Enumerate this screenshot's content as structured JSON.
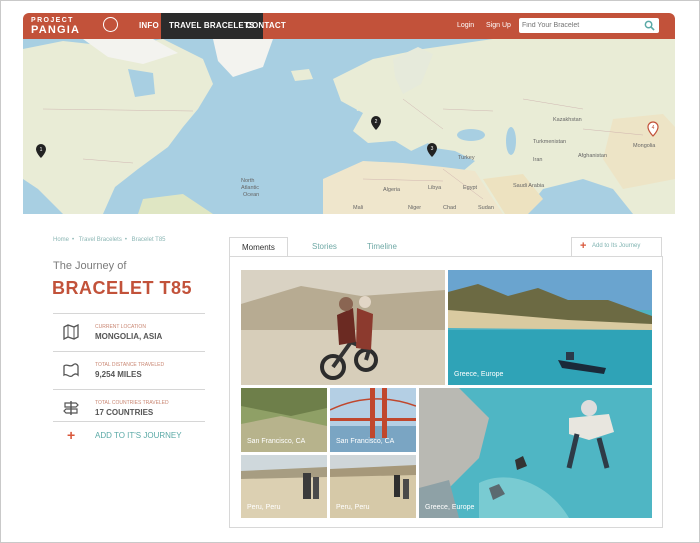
{
  "header": {
    "logo_line1": "PROJECT",
    "logo_line2": "PANGIA",
    "nav": {
      "info": "INFO",
      "bracelets": "TRAVEL BRACELETS",
      "contact": "CONTACT"
    },
    "login": "Login",
    "signup": "Sign Up",
    "search_placeholder": "Find Your Bracelet",
    "search_icon": "search-icon"
  },
  "map": {
    "markers": [
      "1",
      "2",
      "3",
      "4"
    ],
    "labels": [
      "North Atlantic Ocean",
      "Algeria",
      "Libya",
      "Egypt",
      "Saudi Arabia",
      "Kazakhstan",
      "Mongolia",
      "Turkey",
      "Iran",
      "Afghanistan",
      "Turkmenistan",
      "Mali",
      "Niger",
      "Chad",
      "Sudan"
    ]
  },
  "breadcrumb": [
    "Home",
    "Travel Bracelets",
    "Bracelet T85"
  ],
  "journey": {
    "title": "The Journey of",
    "name": "BRACELET T85",
    "stats": [
      {
        "label": "Current Location",
        "value": "MONGOLIA, ASIA",
        "icon": "map-icon"
      },
      {
        "label": "Total Distance Traveled",
        "value": "9,254 MILES",
        "icon": "folded-map-icon"
      },
      {
        "label": "Total Countries Traveled",
        "value": "17 COUNTRIES",
        "icon": "signpost-icon"
      }
    ],
    "add_label": "ADD TO IT'S JOURNEY"
  },
  "tabs": [
    "Moments",
    "Stories",
    "Timeline"
  ],
  "add_right": "Add to Its Journey",
  "photos": [
    {
      "caption": ""
    },
    {
      "caption": "Greece, Europe"
    },
    {
      "caption": "San Francisco, CA"
    },
    {
      "caption": "San Francisco, CA"
    },
    {
      "caption": "Greece, Europe"
    },
    {
      "caption": "Peru, Peru"
    },
    {
      "caption": "Peru, Peru"
    }
  ],
  "colors": {
    "brand": "#c2523a",
    "accent": "#d9573b",
    "teal": "#5aa9a6"
  }
}
